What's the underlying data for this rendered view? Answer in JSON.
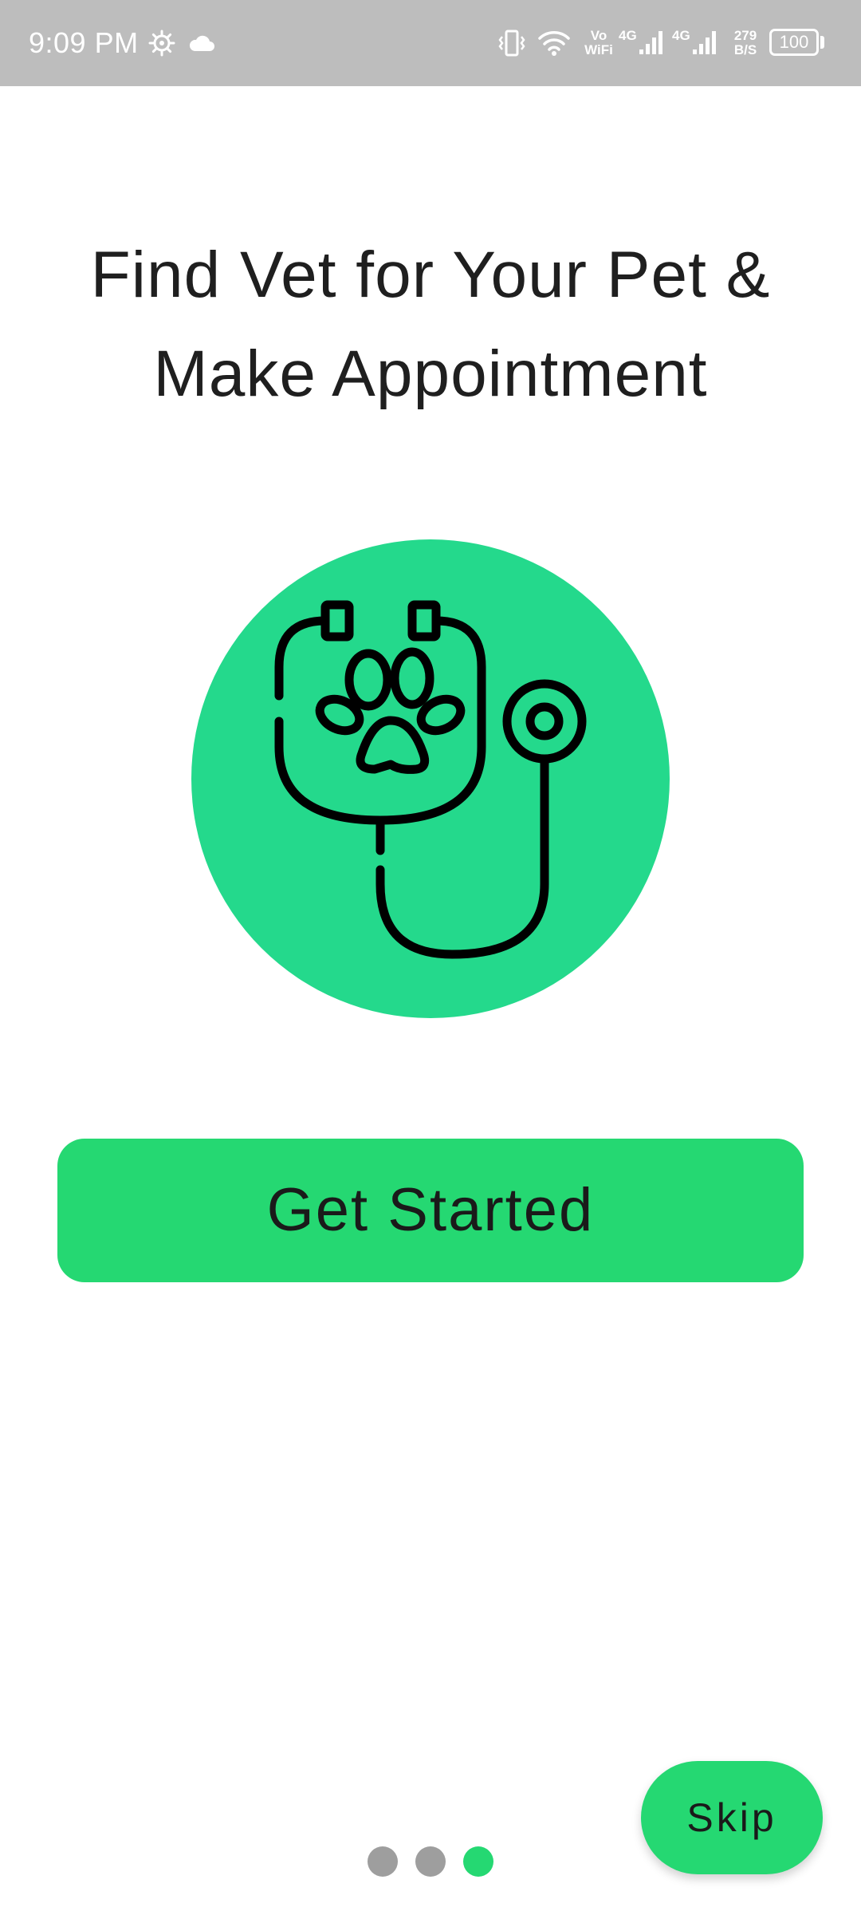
{
  "status_bar": {
    "time": "9:09 PM",
    "vowifi_top": "Vo",
    "vowifi_bottom": "WiFi",
    "sim1_network": "4G",
    "sim2_network": "4G",
    "speed_value": "279",
    "speed_unit": "B/S",
    "battery_level": "100",
    "icons": [
      "gear-icon",
      "cloud-icon",
      "vibrate-icon",
      "wifi-icon",
      "signal-icon",
      "signal-icon",
      "battery-icon"
    ]
  },
  "onboarding": {
    "headline_line1": "Find Vet for Your Pet &",
    "headline_line2": "Make Appointment",
    "illustration_icon": "stethoscope-paw-icon",
    "cta_label": "Get Started",
    "skip_label": "Skip",
    "page_count": 3,
    "current_page": 3
  },
  "colors": {
    "status_bar_bg": "#bdbdbd",
    "illustration_bg": "#24d98c",
    "accent": "#25d872",
    "text": "#1f1f1f",
    "dot_inactive": "#9e9e9e",
    "dot_active": "#25d872"
  }
}
